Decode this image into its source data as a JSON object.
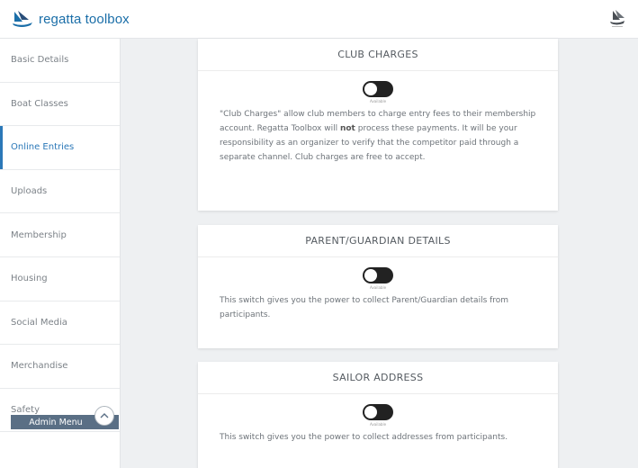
{
  "app": {
    "brand_name": "regatta toolbox",
    "brand_color": "#1a6ea8",
    "accent_color": "#2b78b8"
  },
  "sidebar": {
    "items": [
      {
        "label": "Basic Details",
        "active": false
      },
      {
        "label": "Boat Classes",
        "active": false
      },
      {
        "label": "Online Entries",
        "active": true
      },
      {
        "label": "Uploads",
        "active": false
      },
      {
        "label": "Membership",
        "active": false
      },
      {
        "label": "Housing",
        "active": false
      },
      {
        "label": "Social Media",
        "active": false
      },
      {
        "label": "Merchandise",
        "active": false
      },
      {
        "label": "Safety",
        "active": false
      }
    ],
    "admin_menu_label": "Admin Menu"
  },
  "cards": [
    {
      "title": "CLUB CHARGES",
      "toggle_caption": "Available",
      "text_before_bold": "\"Club Charges\" allow club members to charge entry fees to their membership account. Regatta Toolbox will ",
      "text_bold": "not",
      "text_after_bold": " process these payments. It will be your responsibility as an organizer to verify that the competitor paid through a separate channel. Club charges are free to accept."
    },
    {
      "title": "PARENT/GUARDIAN DETAILS",
      "toggle_caption": "Available",
      "text": "This switch gives you the power to collect Parent/Guardian details from participants."
    },
    {
      "title": "SAILOR ADDRESS",
      "toggle_caption": "Available",
      "text": "This switch gives you the power to collect addresses from participants."
    }
  ]
}
